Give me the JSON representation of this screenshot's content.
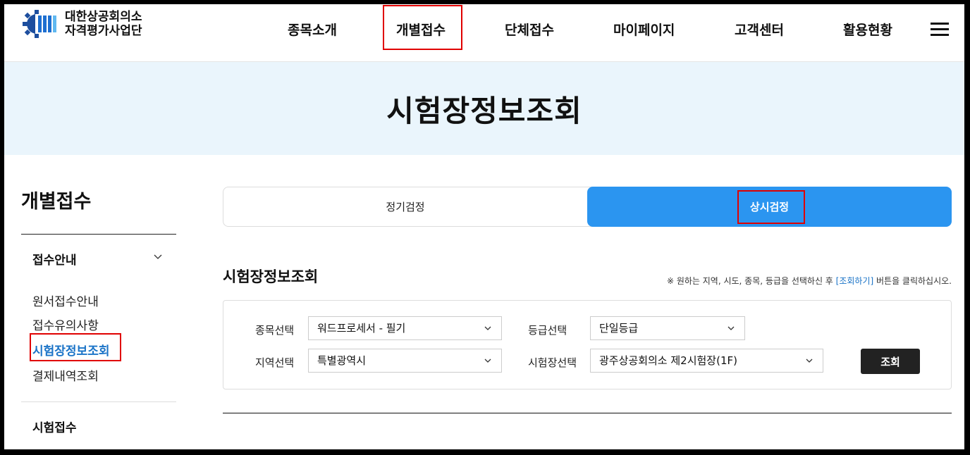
{
  "header": {
    "logo_line1": "대한상공회의소",
    "logo_line2": "자격평가사업단",
    "nav": [
      "종목소개",
      "개별접수",
      "단체접수",
      "마이페이지",
      "고객센터",
      "활용현황"
    ]
  },
  "banner": {
    "title": "시험장정보조회"
  },
  "sidebar": {
    "title": "개별접수",
    "group1": "접수안내",
    "links": [
      "원서접수안내",
      "접수유의사항",
      "시험장정보조회",
      "결제내역조회"
    ],
    "group2": "시험접수"
  },
  "tabs": {
    "left": "정기검정",
    "right": "상시검정"
  },
  "section": {
    "title": "시험장정보조회",
    "note_pre": "※ 원하는 지역, 시도, 종목, 등급을 선택하신 후 ",
    "note_link": "[조회하기]",
    "note_post": " 버튼을 클릭하십시오."
  },
  "form": {
    "subject_label": "종목선택",
    "subject_value": "워드프로세서 - 필기",
    "grade_label": "등급선택",
    "grade_value": "단일등급",
    "region_label": "지역선택",
    "region_value": "특별광역시",
    "venue_label": "시험장선택",
    "venue_value": "광주상공회의소 제2시험장(1F)",
    "search_button": "조회"
  },
  "colors": {
    "accent": "#2b95f0",
    "highlight": "#e00000",
    "banner_bg": "#eaf5fc",
    "link": "#1a73c7"
  }
}
